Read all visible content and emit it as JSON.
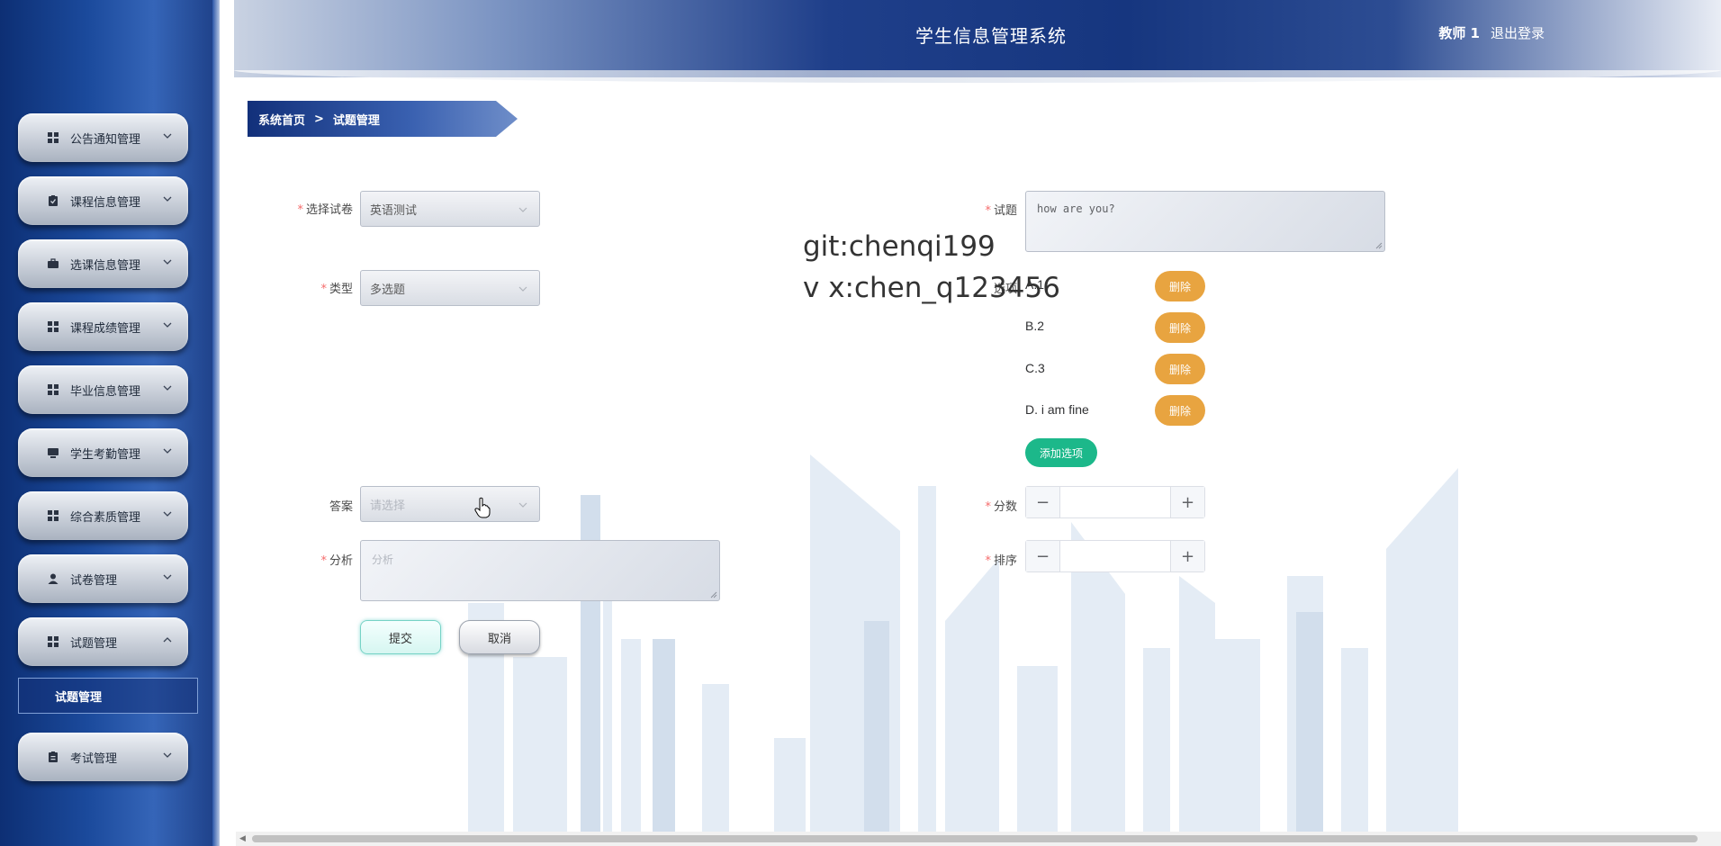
{
  "app": {
    "title": "学生信息管理系统",
    "user": "教师 1",
    "logout": "退出登录"
  },
  "sidebar": {
    "items": [
      {
        "label": "公告通知管理",
        "icon": "grid-icon"
      },
      {
        "label": "课程信息管理",
        "icon": "clipboard-check-icon"
      },
      {
        "label": "选课信息管理",
        "icon": "briefcase-icon"
      },
      {
        "label": "课程成绩管理",
        "icon": "grid-icon"
      },
      {
        "label": "毕业信息管理",
        "icon": "grid-icon"
      },
      {
        "label": "学生考勤管理",
        "icon": "monitor-icon"
      },
      {
        "label": "综合素质管理",
        "icon": "grid-icon"
      },
      {
        "label": "试卷管理",
        "icon": "user-icon"
      },
      {
        "label": "试题管理",
        "icon": "grid-icon",
        "expanded": true
      },
      {
        "label": "考试管理",
        "icon": "clipboard-icon"
      }
    ],
    "submenu": {
      "label": "试题管理"
    }
  },
  "breadcrumb": {
    "home": "系统首页",
    "separator": ">",
    "current": "试题管理"
  },
  "form": {
    "paper": {
      "label": "选择试卷",
      "value": "英语测试"
    },
    "type": {
      "label": "类型",
      "value": "多选题"
    },
    "answer": {
      "label": "答案",
      "placeholder": "请选择"
    },
    "analysis": {
      "label": "分析",
      "placeholder": "分析"
    },
    "question": {
      "label": "试题",
      "value": "how are you?"
    },
    "options_label": "选项",
    "options": [
      {
        "text": "A.1",
        "delete": "删除"
      },
      {
        "text": "B.2",
        "delete": "删除"
      },
      {
        "text": "C.3",
        "delete": "删除"
      },
      {
        "text": "D. i am fine",
        "delete": "删除"
      }
    ],
    "add_option": "添加选项",
    "score": {
      "label": "分数",
      "value": ""
    },
    "order": {
      "label": "排序",
      "value": ""
    },
    "submit": "提交",
    "cancel": "取消"
  },
  "watermark": {
    "line1": "git:chenqi199",
    "line2": "v x:chen_q123456"
  },
  "colors": {
    "accent_blue": "#16367f",
    "delete_orange": "#e8a440",
    "add_green": "#1cb88a",
    "required_red": "#f56c6c"
  }
}
